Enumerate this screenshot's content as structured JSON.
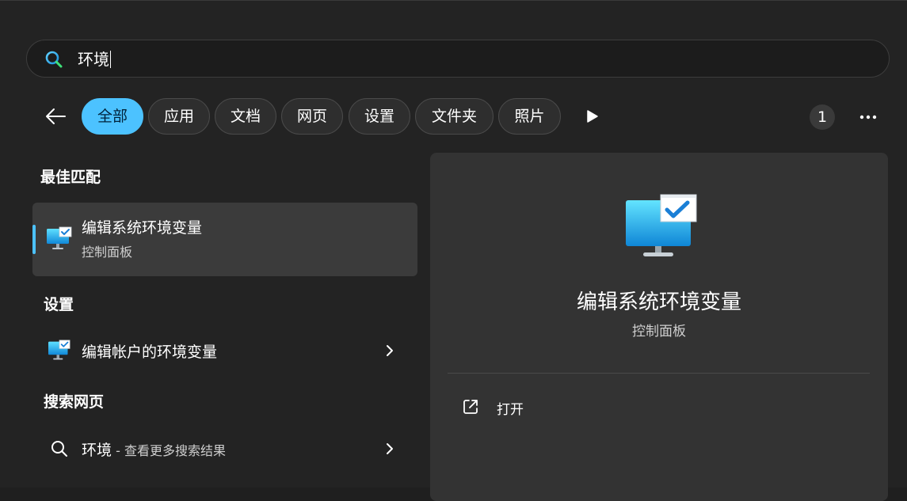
{
  "search": {
    "query": "环境"
  },
  "filters": {
    "chips": [
      {
        "label": "全部",
        "active": true
      },
      {
        "label": "应用",
        "active": false
      },
      {
        "label": "文档",
        "active": false
      },
      {
        "label": "网页",
        "active": false
      },
      {
        "label": "设置",
        "active": false
      },
      {
        "label": "文件夹",
        "active": false
      },
      {
        "label": "照片",
        "active": false
      }
    ],
    "badge_count": "1"
  },
  "results": {
    "best_match_header": "最佳匹配",
    "best_match": {
      "title": "编辑系统环境变量",
      "subtitle": "控制面板",
      "icon": "monitor-check-icon"
    },
    "settings_header": "设置",
    "settings_item": {
      "title": "编辑帐户的环境变量",
      "icon": "monitor-check-icon"
    },
    "web_header": "搜索网页",
    "web_item": {
      "query": "环境",
      "suffix": " - 查看更多搜索结果",
      "icon": "search-icon"
    }
  },
  "preview": {
    "title": "编辑系统环境变量",
    "subtitle": "控制面板",
    "actions": [
      {
        "label": "打开",
        "icon": "open-external-icon"
      }
    ]
  },
  "colors": {
    "accent": "#4cc2ff",
    "background": "#232323",
    "panel": "#333333",
    "selected_item": "#3b3b3b"
  }
}
